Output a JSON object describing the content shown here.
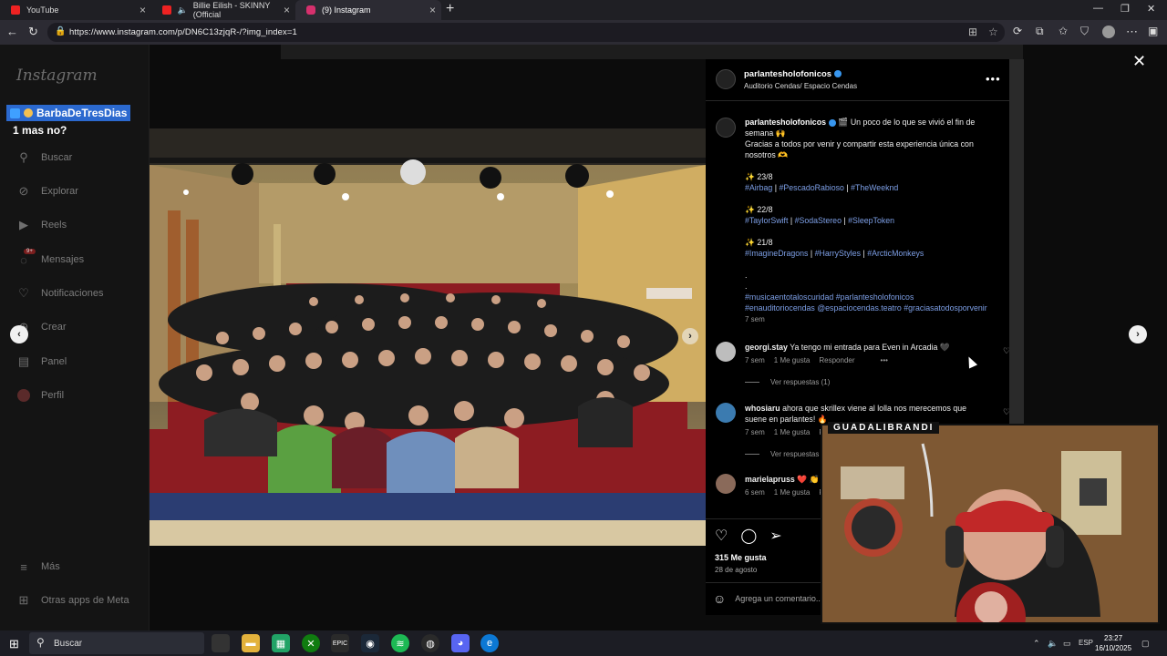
{
  "browser": {
    "tabs": [
      {
        "label": "YouTube"
      },
      {
        "label": "Billie Eilish - SKINNY (Official"
      },
      {
        "label": "(9) Instagram"
      }
    ],
    "url": "https://www.instagram.com/p/DN6C13zjqR-/?img_index=1"
  },
  "sidebar": {
    "logo": "Instagram",
    "items": [
      {
        "label": "Buscar",
        "icon": "search-icon"
      },
      {
        "label": "Explorar",
        "icon": "compass-icon"
      },
      {
        "label": "Reels",
        "icon": "reels-icon"
      },
      {
        "label": "Mensajes",
        "icon": "messenger-icon",
        "badge": "9+"
      },
      {
        "label": "Notificaciones",
        "icon": "heart-icon"
      },
      {
        "label": "Crear",
        "icon": "plus-icon"
      },
      {
        "label": "Panel",
        "icon": "chart-icon"
      },
      {
        "label": "Perfil",
        "icon": "avatar-icon"
      }
    ],
    "bottom": [
      {
        "label": "Más",
        "icon": "menu-icon"
      },
      {
        "label": "Otras apps de Meta",
        "icon": "grid-icon"
      }
    ]
  },
  "stream_overlay": {
    "name": "BarbaDeTresDias",
    "subtitle": "1 mas no?"
  },
  "post": {
    "username": "parlantesholofonicos",
    "location": "Auditorio Cendas/ Espacio Cendas",
    "caption": {
      "intro": "🎬 Un poco de lo que se vivió el fin de semana 🙌",
      "thanks": "Gracias a todos por venir y compartir esta experiencia única con nosotros 🫶",
      "days": [
        {
          "date": "✨ 23/8",
          "tags": [
            "#Airbag",
            "#PescadoRabioso",
            "#TheWeeknd"
          ]
        },
        {
          "date": "✨ 22/8",
          "tags": [
            "#TaylorSwift",
            "#SodaStereo",
            "#SleepToken"
          ]
        },
        {
          "date": "✨ 21/8",
          "tags": [
            "#ImagineDragons",
            "#HarryStyles",
            "#ArcticMonkeys"
          ]
        }
      ],
      "footer_tags_1": "#musicaentotaloscuridad #parlantesholofonicos",
      "footer_tags_2": "#enauditoriocendas @espaciocendas.teatro #graciasatodosporvenir",
      "time": "7 sem"
    },
    "comments": [
      {
        "user": "georgi.stay",
        "text": "Ya tengo mi entrada para Even in Arcadia 🖤",
        "time": "7 sem",
        "likes": "1 Me gusta",
        "reply": "Responder",
        "replies": "Ver respuestas (1)"
      },
      {
        "user": "whosiaru",
        "text": "ahora que skrillex viene al lolla nos merecemos que suene en parlantes! 🔥",
        "time": "7 sem",
        "likes": "1 Me gusta",
        "reply": "Re",
        "replies": "Ver respuestas"
      },
      {
        "user": "marielapruss",
        "text": "❤️ 👏",
        "time": "6 sem",
        "likes": "1 Me gusta",
        "reply": "R"
      }
    ],
    "likes": "315 Me gusta",
    "date": "28 de agosto",
    "add_comment_placeholder": "Agrega un comentario..."
  },
  "webcam": {
    "title": "GUADALIBRANDI"
  },
  "taskbar": {
    "search": "Buscar",
    "lang": "ESP",
    "time": "23:27",
    "date": "16/10/2025"
  }
}
